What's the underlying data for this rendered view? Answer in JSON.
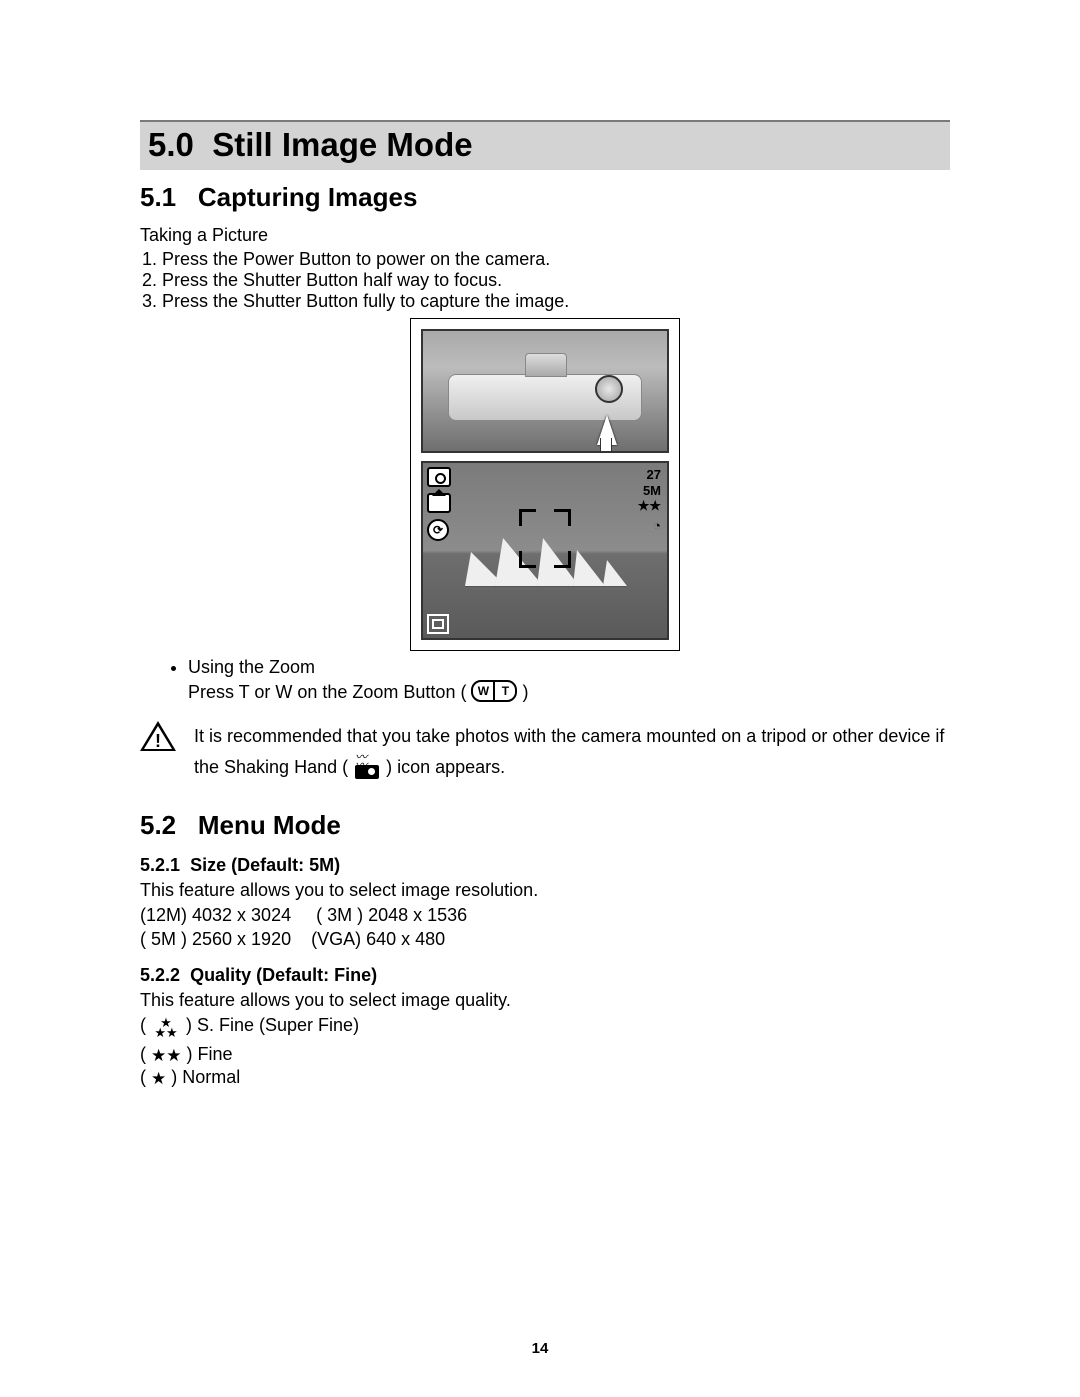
{
  "section50": {
    "number": "5.0",
    "title": "Still Image Mode"
  },
  "section51": {
    "number": "5.1",
    "title": "Capturing Images",
    "intro": "Taking a Picture",
    "steps": [
      "Press the Power Button to power on the camera.",
      "Press the Shutter Button half way to focus.",
      "Press the Shutter Button fully to capture the image."
    ],
    "zoom_bullet": "Using the Zoom",
    "zoom_text_before": "Press T or W on the Zoom Button ( ",
    "zoom_text_after": " )",
    "zoom_w": "W",
    "zoom_t": "T",
    "caution_part1": "It is recommended that you take photos with the camera mounted on a tripod or other device if the Shaking Hand ( ",
    "caution_part2": " ) icon appears."
  },
  "lcd": {
    "count": "27",
    "res": "5M",
    "stars": "★★"
  },
  "section52": {
    "number": "5.2",
    "title": "Menu Mode",
    "s521_num": "5.2.1",
    "s521_title": "Size (Default: 5M)",
    "s521_body": "This feature allows you to select image resolution.",
    "sizes_line1a": "(12M) 4032 x 3024",
    "sizes_line1b": "( 3M )  2048 x 1536",
    "sizes_line2a": "( 5M )  2560 x 1920",
    "sizes_line2b": "(VGA) 640 x 480",
    "s522_num": "5.2.2",
    "s522_title": "Quality (Default: Fine)",
    "s522_body": "This feature allows you to select image quality.",
    "quality": {
      "sfine": "S. Fine (Super Fine)",
      "fine": "Fine",
      "normal": "Normal"
    }
  },
  "page_number": "14"
}
